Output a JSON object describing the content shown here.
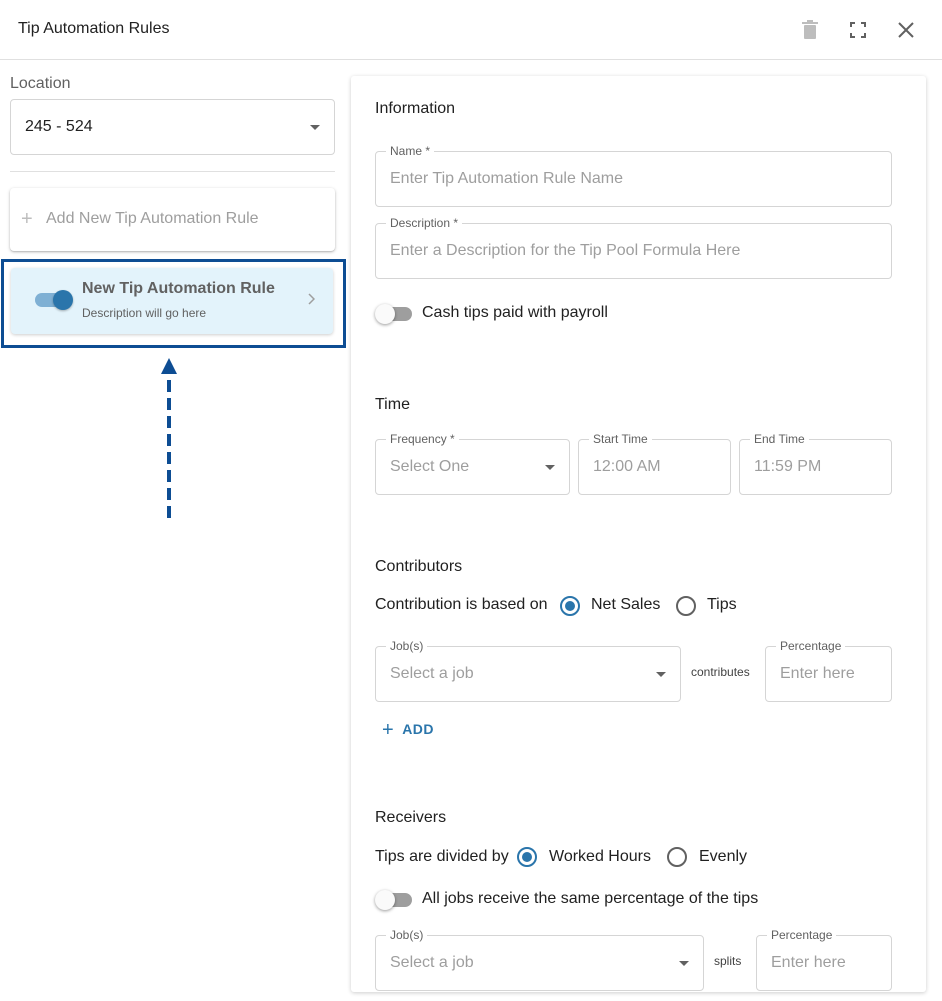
{
  "header": {
    "title": "Tip Automation Rules"
  },
  "sidebar": {
    "location_label": "Location",
    "location_value": "245 - 524",
    "add_rule_label": "Add New Tip Automation Rule",
    "rules": [
      {
        "title": "New Tip Automation Rule",
        "description": "Description will go here",
        "enabled": true
      }
    ]
  },
  "information": {
    "title": "Information",
    "name_label": "Name *",
    "name_placeholder": "Enter Tip Automation Rule Name",
    "description_label": "Description *",
    "description_placeholder": "Enter a Description for the Tip Pool Formula Here",
    "cash_tips_label": "Cash tips paid with payroll"
  },
  "time": {
    "title": "Time",
    "frequency_label": "Frequency *",
    "frequency_placeholder": "Select One",
    "start_label": "Start Time",
    "start_value": "12:00 AM",
    "end_label": "End Time",
    "end_value": "11:59 PM"
  },
  "contributors": {
    "title": "Contributors",
    "based_on_label": "Contribution is based on",
    "options": [
      "Net Sales",
      "Tips"
    ],
    "selected": "Net Sales",
    "jobs_label": "Job(s)",
    "jobs_placeholder": "Select a job",
    "connector": "contributes",
    "percentage_label": "Percentage",
    "percentage_placeholder": "Enter here",
    "add_label": "ADD"
  },
  "receivers": {
    "title": "Receivers",
    "divided_by_label": "Tips are divided by",
    "options": [
      "Worked Hours",
      "Evenly"
    ],
    "selected": "Worked Hours",
    "same_percentage_label": "All jobs receive the same percentage of the tips",
    "jobs_label": "Job(s)",
    "jobs_placeholder": "Select a job",
    "connector": "splits",
    "percentage_label": "Percentage",
    "percentage_placeholder": "Enter here"
  },
  "colors": {
    "accent": "#2a75ab",
    "highlight_border": "#0d4d93",
    "selected_card_bg": "#e3f3fb"
  },
  "icons": [
    "trash-icon",
    "fullscreen-icon",
    "close-icon",
    "plus-icon",
    "chevron-right-icon",
    "chevron-down-icon",
    "up-arrow-annotation"
  ]
}
